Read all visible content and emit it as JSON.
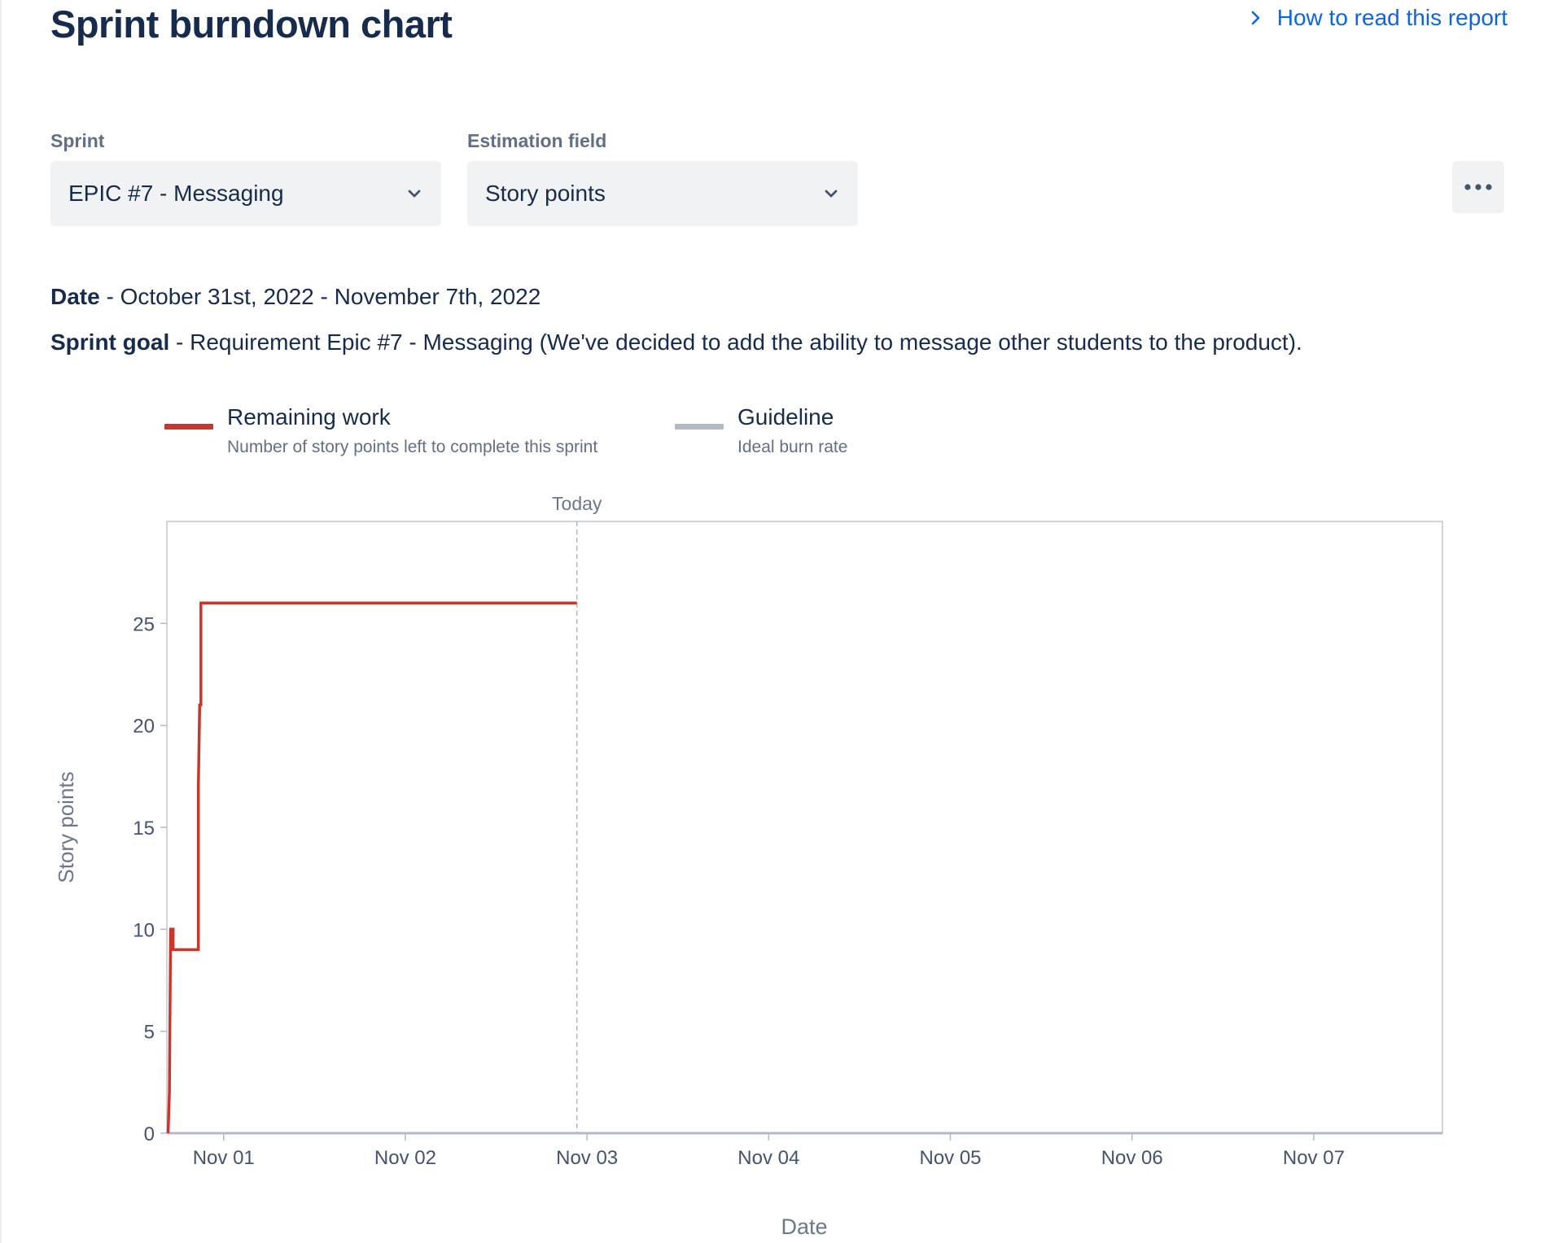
{
  "page": {
    "title": "Sprint burndown chart",
    "help_link": "How to read this report"
  },
  "filters": {
    "sprint_label": "Sprint",
    "sprint_value": "EPIC #7 - Messaging",
    "estimation_label": "Estimation field",
    "estimation_value": "Story points"
  },
  "info": {
    "date_label": "Date",
    "date_value": " - October 31st, 2022 - November 7th, 2022",
    "goal_label": "Sprint goal",
    "goal_value": " - Requirement Epic #7 - Messaging (We've decided to add the ability to message other students to the product)."
  },
  "legend": [
    {
      "title": "Remaining work",
      "subtitle": "Number of story points left to complete this sprint",
      "color": "#c9372c"
    },
    {
      "title": "Guideline",
      "subtitle": "Ideal burn rate",
      "color": "#b3b9c4"
    }
  ],
  "icons": {
    "help": "chevron-right-icon",
    "dropdown": "chevron-down-icon",
    "more": "more-horizontal-icon"
  },
  "chart_data": {
    "type": "line",
    "xlabel": "Date",
    "ylabel": "Story points",
    "x_ticks": [
      "Nov 01",
      "Nov 02",
      "Nov 03",
      "Nov 04",
      "Nov 05",
      "Nov 06",
      "Nov 07"
    ],
    "x_range": [
      "2022-10-31T16:30",
      "2022-11-07T17:00"
    ],
    "ylim": [
      0,
      30
    ],
    "y_ticks": [
      0,
      5,
      10,
      15,
      20,
      25
    ],
    "today_label": "Today",
    "today": "2022-11-02T22:40",
    "series": [
      {
        "name": "Remaining work",
        "color": "#c9372c",
        "points": [
          {
            "x": "2022-10-31T16:40",
            "y": 0
          },
          {
            "x": "2022-10-31T16:50",
            "y": 2
          },
          {
            "x": "2022-10-31T17:00",
            "y": 10
          },
          {
            "x": "2022-10-31T17:20",
            "y": 10
          },
          {
            "x": "2022-10-31T17:20",
            "y": 9
          },
          {
            "x": "2022-10-31T20:40",
            "y": 9
          },
          {
            "x": "2022-10-31T20:40",
            "y": 17
          },
          {
            "x": "2022-10-31T20:50",
            "y": 21
          },
          {
            "x": "2022-10-31T21:00",
            "y": 21
          },
          {
            "x": "2022-10-31T21:00",
            "y": 26
          },
          {
            "x": "2022-11-02T22:40",
            "y": 26
          }
        ]
      }
    ]
  }
}
